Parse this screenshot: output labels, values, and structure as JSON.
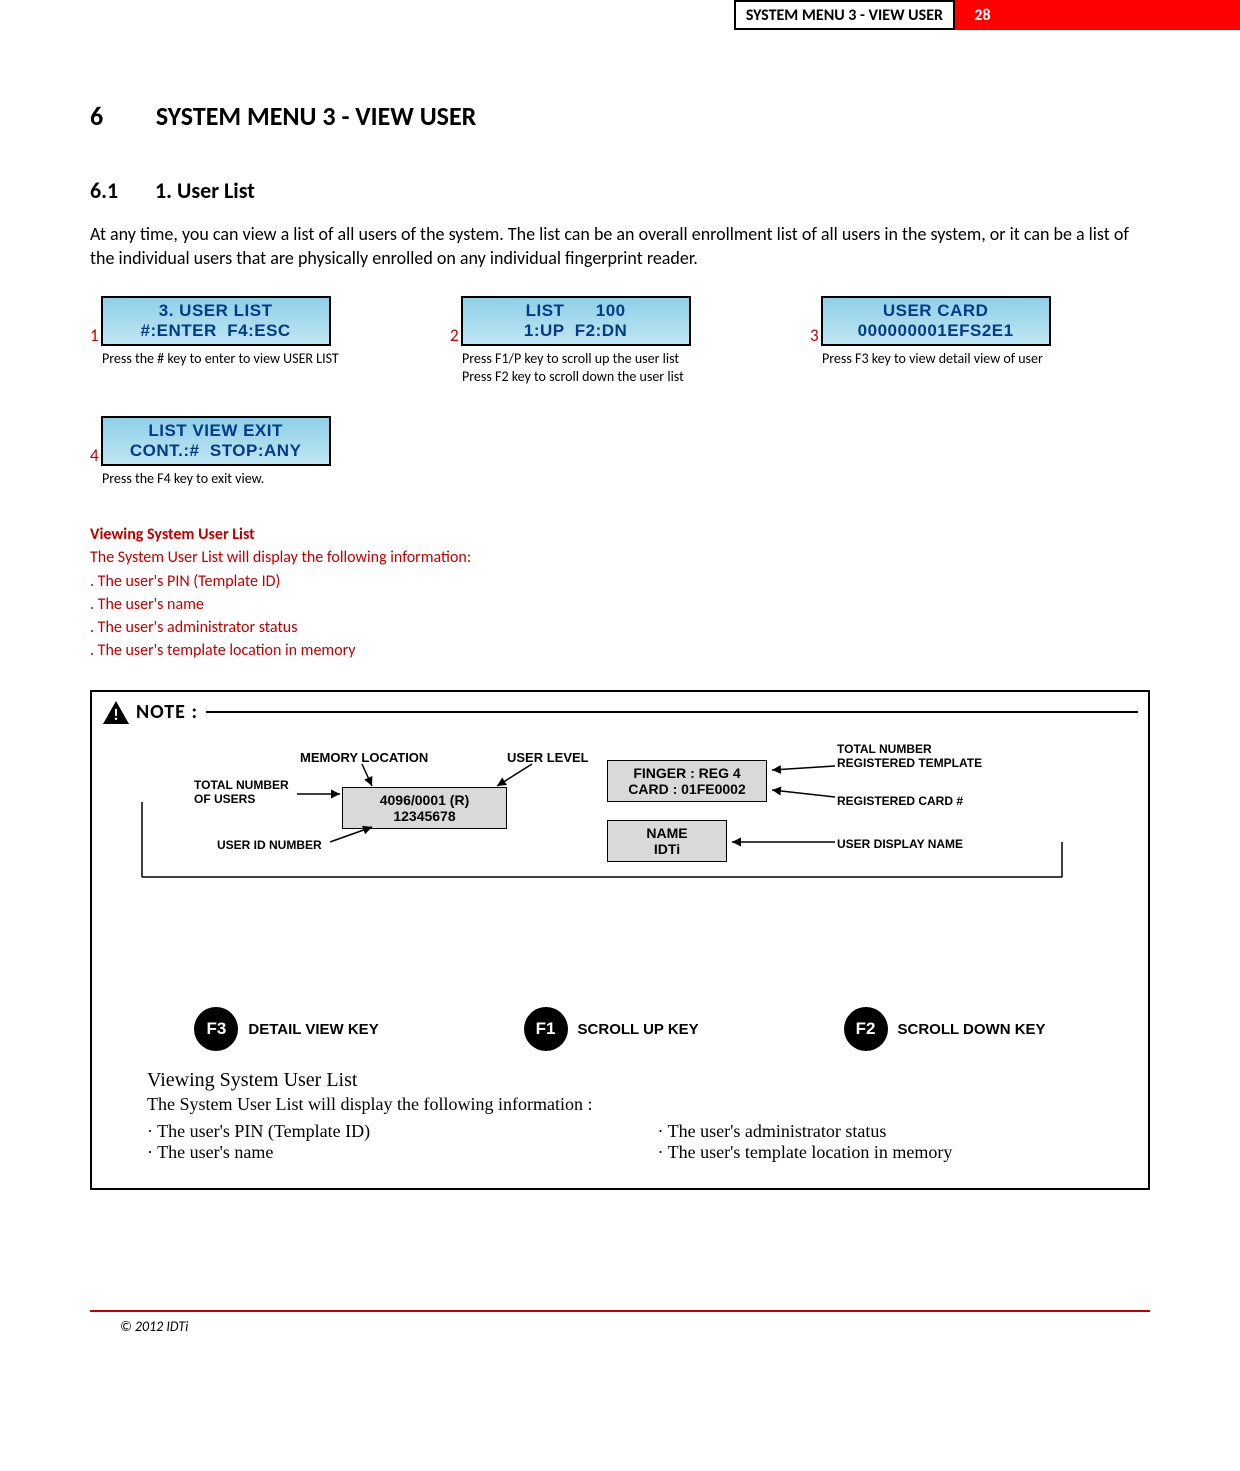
{
  "header": {
    "title": "SYSTEM MENU 3 - VIEW USER",
    "page": "28"
  },
  "section": {
    "num": "6",
    "title": "SYSTEM MENU 3 - VIEW USER"
  },
  "subsection": {
    "num": "6.1",
    "title": "1. User List"
  },
  "intro": "At any time, you can view a list of all users of the system. The list can be an overall enrollment list of all users in the system, or it can be a list of the individual users that are physically enrolled on any individual fingerprint reader.",
  "lcd": [
    {
      "num": "1",
      "l1": "3. USER LIST",
      "l2": "#:ENTER  F4:ESC",
      "caption1": "Press the # key to enter to view USER LIST",
      "caption2": ""
    },
    {
      "num": "2",
      "l1": "LIST      100",
      "l2": "1:UP  F2:DN",
      "caption1": "Press F1/P key to scroll up the user list",
      "caption2": "Press F2 key to scroll down the user list"
    },
    {
      "num": "3",
      "l1": "USER CARD",
      "l2": "000000001EFS2E1",
      "caption1": "Press F3 key to view detail view of user",
      "caption2": ""
    },
    {
      "num": "4",
      "l1": "LIST VIEW EXIT",
      "l2": "CONT.:#  STOP:ANY",
      "caption1": "Press the F4 key to exit view.",
      "caption2": ""
    }
  ],
  "redlist": {
    "head": "Viewing System User List",
    "line1": "The System User List will display the following information:",
    "items": [
      ". The user's PIN (Template ID)",
      ". The user's name",
      ". The user's administrator status",
      ". The user's template location in memory"
    ]
  },
  "diagram": {
    "note": "NOTE :",
    "labels": {
      "memloc": "MEMORY LOCATION",
      "userlevel": "USER LEVEL",
      "totalreg": "TOTAL NUMBER REGISTERED TEMPLATE",
      "totalusers": "TOTAL NUMBER OF USERS",
      "userid": "USER ID NUMBER",
      "regcard": "REGISTERED CARD #",
      "dispname": "USER DISPLAY NAME"
    },
    "box1_l1": "4096/0001    (R)",
    "box1_l2": "12345678",
    "box2_l1": "FINGER : REG  4",
    "box2_l2": "CARD : 01FE0002",
    "box3_l1": "NAME",
    "box3_l2": "IDTi",
    "fkeys": [
      {
        "key": "F3",
        "label": "DETAIL VIEW KEY"
      },
      {
        "key": "F1",
        "label": "SCROLL UP KEY"
      },
      {
        "key": "F2",
        "label": "SCROLL DOWN KEY"
      }
    ],
    "text": {
      "head": "Viewing System User List",
      "line": "The System User List will display the following information :",
      "col1": [
        "The user's PIN (Template ID)",
        "The user's name"
      ],
      "col2": [
        "The user's administrator status",
        "The user's template location in memory"
      ]
    }
  },
  "footer": "© 2012 IDTi"
}
